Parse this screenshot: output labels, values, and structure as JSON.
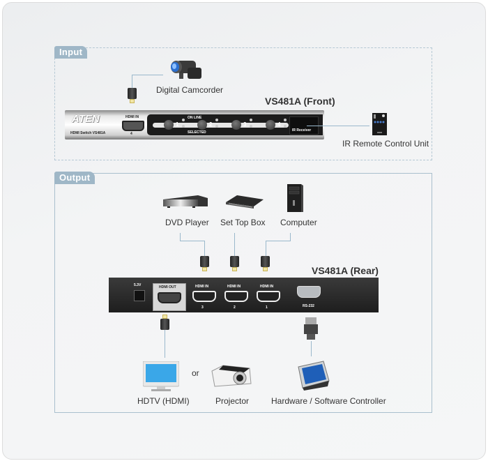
{
  "sections": {
    "input": {
      "label": "Input"
    },
    "output": {
      "label": "Output"
    }
  },
  "front": {
    "title": "VS481A (Front)",
    "brand": "ATEN",
    "model_text": "HDMI Switch VS481A",
    "hdmi_in_label": "HDMI IN",
    "hdmi_in_port": "4",
    "online_label": "ON LINE",
    "selected_label": "SELECTED",
    "ports": [
      "1",
      "2",
      "3",
      "4"
    ],
    "ir_label": "IR Receiver"
  },
  "rear": {
    "title": "VS481A (Rear)",
    "power_label": "5.3V",
    "hdmi_out_label": "HDMI OUT",
    "hdmi_in_label": "HDMI IN",
    "hdmi_in_ports": [
      "3",
      "2",
      "1"
    ],
    "rs232_label": "RS-232"
  },
  "devices": {
    "camcorder": {
      "label": "Digital Camcorder",
      "icon": "camcorder-icon"
    },
    "ir_remote": {
      "label": "IR Remote Control Unit",
      "icon": "remote-control-icon"
    },
    "dvd": {
      "label": "DVD Player",
      "icon": "dvd-player-icon"
    },
    "stb": {
      "label": "Set Top Box",
      "icon": "set-top-box-icon"
    },
    "computer": {
      "label": "Computer",
      "icon": "computer-tower-icon"
    },
    "hdtv": {
      "label": "HDTV (HDMI)",
      "icon": "monitor-icon"
    },
    "or_text": "or",
    "projector": {
      "label": "Projector",
      "icon": "projector-icon"
    },
    "controller": {
      "label": "Hardware / Software Controller",
      "icon": "touch-panel-icon"
    }
  }
}
